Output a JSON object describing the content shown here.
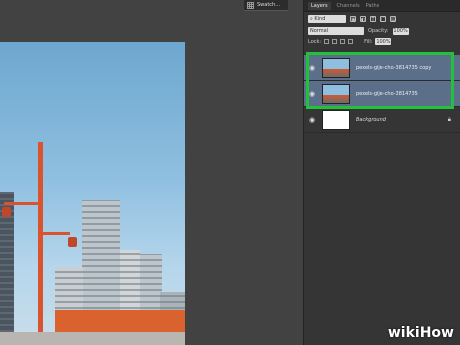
{
  "top": {
    "swatches_tab": "Swatch..."
  },
  "panel": {
    "tabs": [
      "Layers",
      "Channels",
      "Paths"
    ],
    "filter": {
      "kind": "Kind"
    },
    "blend_mode": "Normal",
    "opacity_label": "Opacity:",
    "opacity_value": "100%",
    "lock_label": "Lock:",
    "fill_label": "Fill:",
    "fill_value": "100%",
    "layers": [
      {
        "name": "pexels-gije-cho-3814735 copy",
        "selected": true
      },
      {
        "name": "pexels-gije-cho-3814735",
        "selected": false
      },
      {
        "name": "Background",
        "locked": true
      }
    ]
  },
  "watermark": "wikiHow",
  "colors": {
    "highlight": "#22c13a",
    "selected_layer": "#5b6e8a"
  }
}
